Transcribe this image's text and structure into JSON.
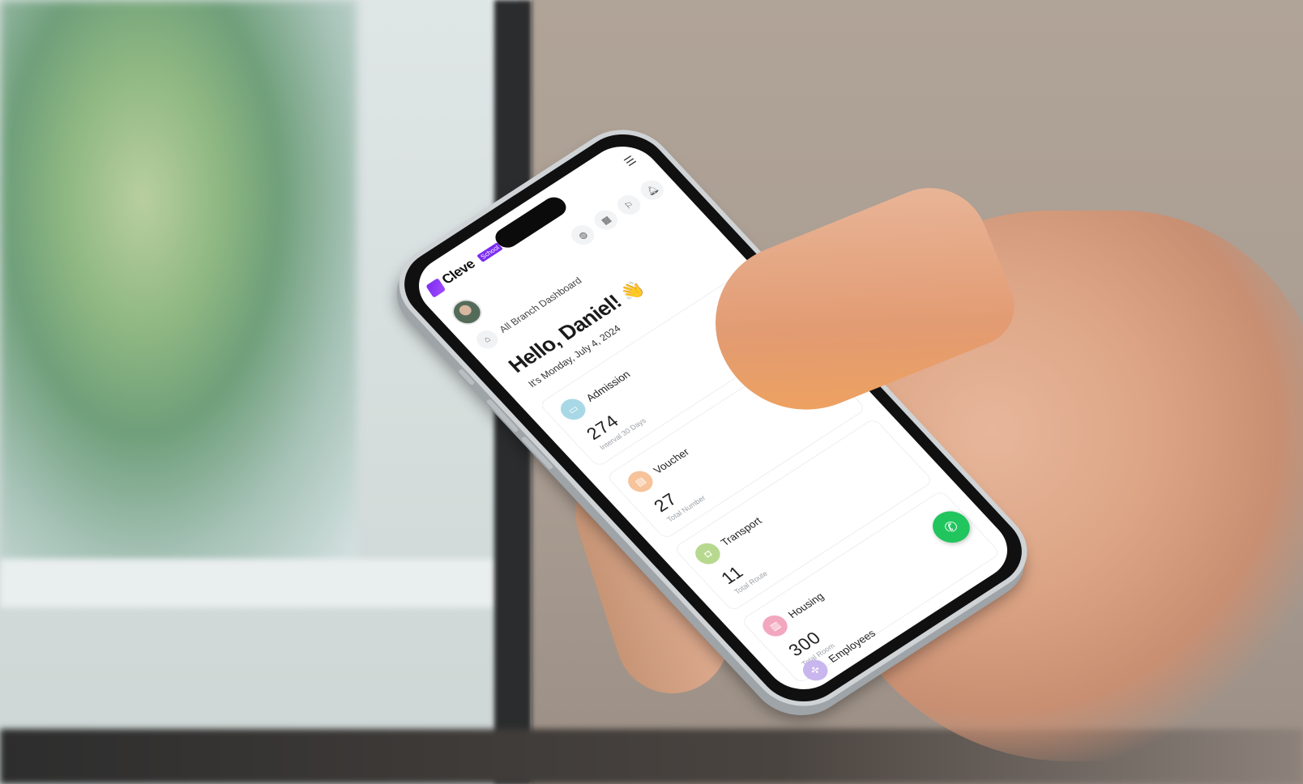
{
  "app": {
    "logo_text": "Cleve",
    "logo_badge": "School"
  },
  "breadcrumb": {
    "label": "All Branch Dashboard"
  },
  "greeting": {
    "title": "Hello, Daniel!",
    "wave": "👋",
    "date": "It's Monday, July 4, 2024"
  },
  "toolbar": {
    "icons": [
      "globe-icon",
      "calendar-icon",
      "flag-icon",
      "bell-icon"
    ]
  },
  "cards": [
    {
      "title": "Admission",
      "value": "274",
      "sub": "Interval 30 Days",
      "color": "#a8d8e6"
    },
    {
      "title": "Voucher",
      "value": "27",
      "sub": "Total Number",
      "color": "#f6c39a"
    },
    {
      "title": "Transport",
      "value": "11",
      "sub": "Total Route",
      "color": "#b7d98f"
    },
    {
      "title": "Housing",
      "value": "300",
      "sub": "Total Room",
      "color": "#f2a7bf"
    }
  ],
  "partial_card": {
    "title": "Employees",
    "color": "#c9b6ee"
  },
  "fab": {
    "icon": "whatsapp-icon",
    "color": "#21c55d"
  }
}
